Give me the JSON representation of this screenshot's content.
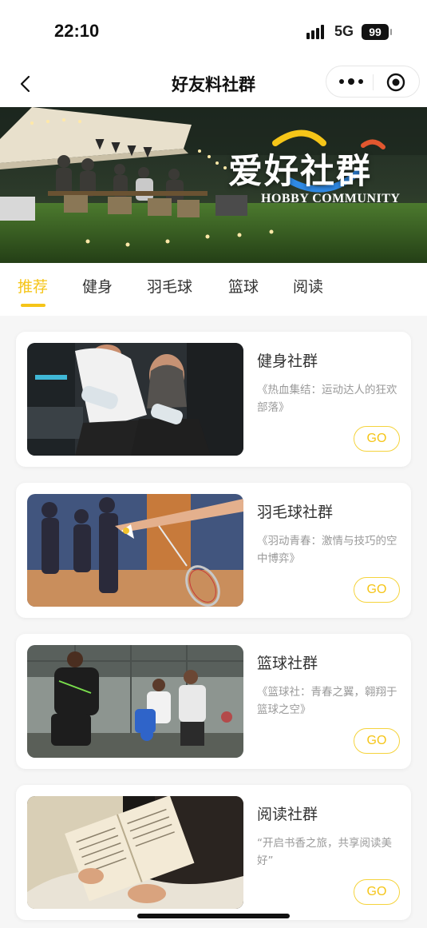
{
  "status_bar": {
    "time": "22:10",
    "network": "5G",
    "battery": "99"
  },
  "nav": {
    "title": "好友料社群",
    "icons": [
      "back-arrow-icon",
      "more-dots-icon",
      "close-target-icon"
    ]
  },
  "banner": {
    "title": "爱好社群",
    "subtitle": "HOBBY COMMUNITY"
  },
  "tabs": [
    {
      "label": "推荐",
      "active": true
    },
    {
      "label": "健身"
    },
    {
      "label": "羽毛球"
    },
    {
      "label": "篮球"
    },
    {
      "label": "阅读"
    }
  ],
  "accent_color": "#f5c518",
  "cards": [
    {
      "title": "健身社群",
      "desc": "《热血集结：运动达人的狂欢部落》",
      "button": "GO"
    },
    {
      "title": "羽毛球社群",
      "desc": "《羽动青春：激情与技巧的空中博弈》",
      "button": "GO"
    },
    {
      "title": "篮球社群",
      "desc": "《篮球社：青春之翼，翱翔于篮球之空》",
      "button": "GO"
    },
    {
      "title": "阅读社群",
      "desc": "“开启书香之旅，共享阅读美好”",
      "button": "GO"
    }
  ]
}
